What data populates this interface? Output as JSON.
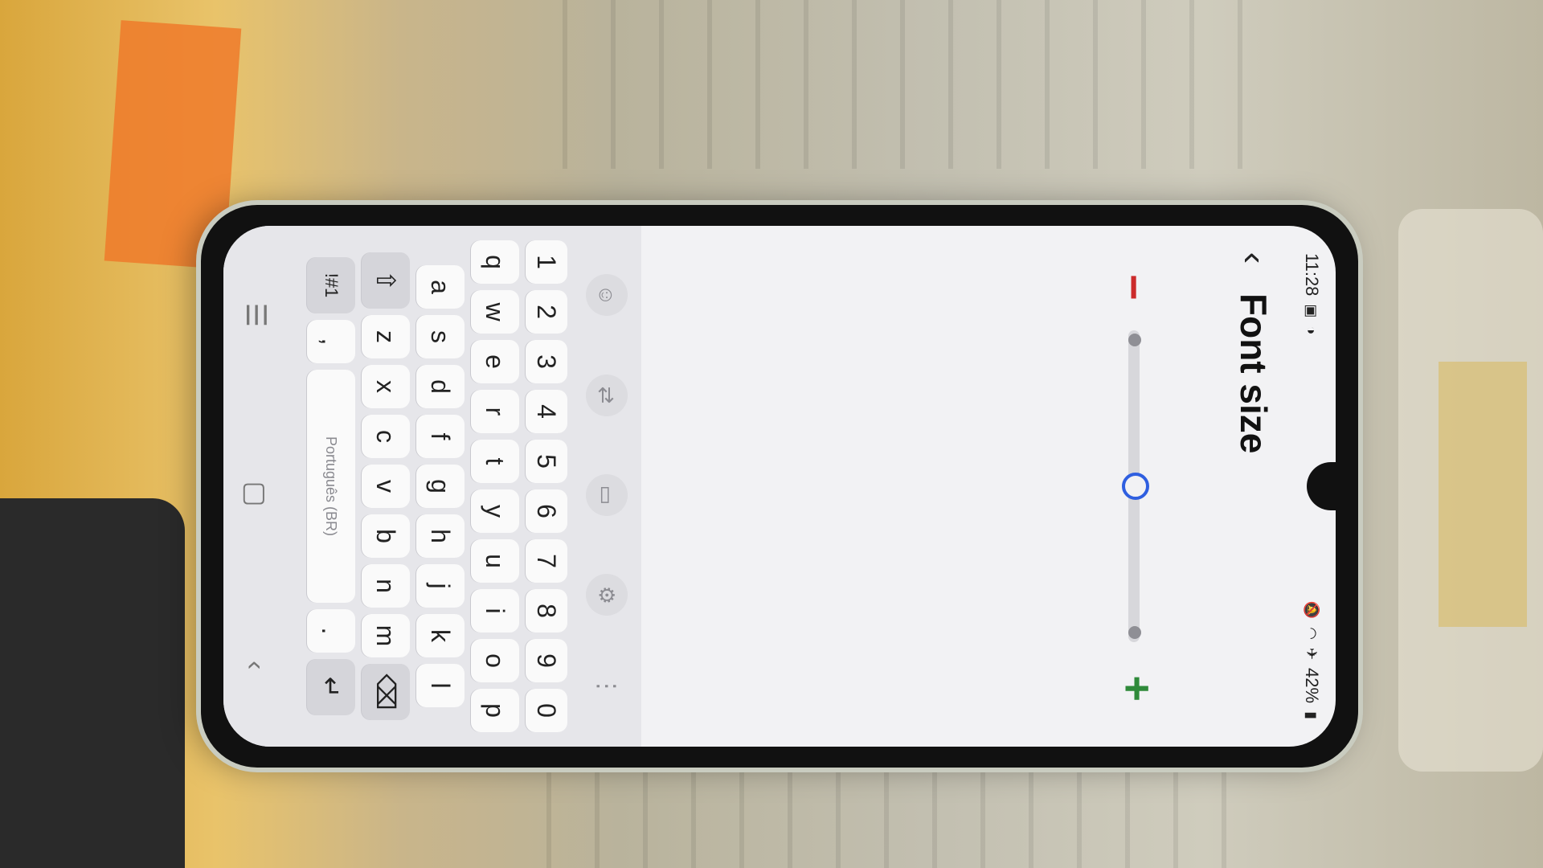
{
  "status_bar": {
    "time": "11:28",
    "battery": "42%",
    "icons": [
      "message-icon",
      "sync-icon",
      "mute-icon",
      "wifi-icon",
      "airplane-icon",
      "battery-icon"
    ]
  },
  "header": {
    "back_icon": "chevron-left-icon",
    "title": "Font size"
  },
  "font_slider": {
    "minus_label": "−",
    "plus_label": "+",
    "value_fraction": 0.5,
    "minus_color": "#cc2b2b",
    "plus_color": "#2f8a3a",
    "accent": "#2f5fe0"
  },
  "keyboard": {
    "toolbar": [
      "emoji-icon",
      "translate-icon",
      "clipboard-icon",
      "settings-icon",
      "more-icon"
    ],
    "number_row": [
      "1",
      "2",
      "3",
      "4",
      "5",
      "6",
      "7",
      "8",
      "9",
      "0"
    ],
    "row1": [
      "q",
      "w",
      "e",
      "r",
      "t",
      "y",
      "u",
      "i",
      "o",
      "p"
    ],
    "row2": [
      "a",
      "s",
      "d",
      "f",
      "g",
      "h",
      "j",
      "k",
      "l"
    ],
    "row3": [
      "z",
      "x",
      "c",
      "v",
      "b",
      "n",
      "m"
    ],
    "symbols_label": "!#1",
    "comma": ",",
    "period": ".",
    "space_label": "Português (BR)"
  },
  "nav_bar": [
    "recents-icon",
    "home-icon",
    "back-icon"
  ]
}
